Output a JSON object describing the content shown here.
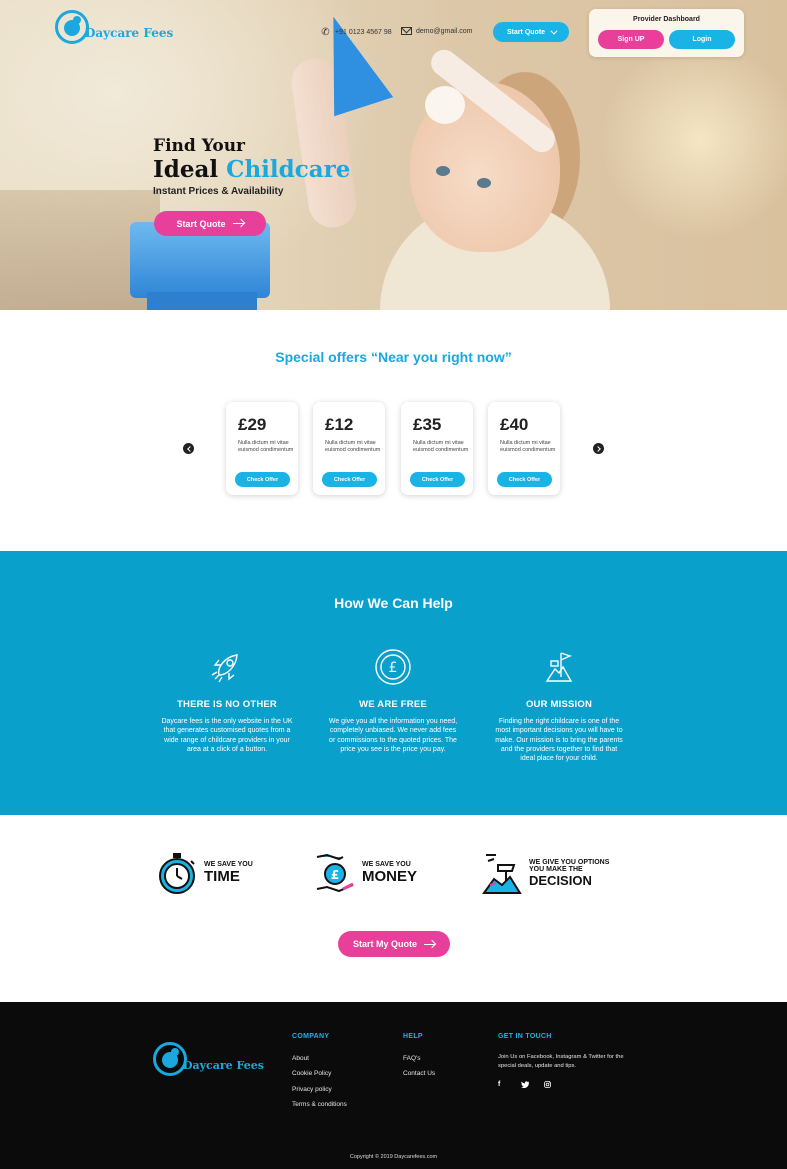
{
  "brand": {
    "name": "Daycare Fees",
    "color": "#1aa8df",
    "accent_pink": "#e8409a"
  },
  "header": {
    "phone": "+91 0123 4567 98",
    "email": "demo@gmail.com",
    "start_quote": "Start Quote",
    "provider_dashboard": {
      "title": "Provider Dashboard",
      "signup": "Sign UP",
      "login": "Login"
    }
  },
  "hero": {
    "line1": "Find Your",
    "line2_a": "Ideal",
    "line2_b": "Childcare",
    "subtitle": "Instant Prices & Availability",
    "cta": "Start Quote"
  },
  "offers": {
    "title": "Special offers “Near you right now”",
    "cards": [
      {
        "price": "£29",
        "desc": "Nulla dictum mi vitae euismod condimentum",
        "cta": "Check Offer"
      },
      {
        "price": "£12",
        "desc": "Nulla dictum mi vitae euismod condimentum",
        "cta": "Check Offer"
      },
      {
        "price": "£35",
        "desc": "Nulla dictum mi vitae euismod condimentum",
        "cta": "Check Offer"
      },
      {
        "price": "£40",
        "desc": "Nulla dictum mi vitae euismod condimentum",
        "cta": "Check Offer"
      }
    ]
  },
  "help": {
    "title": "How We Can Help",
    "columns": [
      {
        "icon": "rocket-icon",
        "heading": "THERE IS NO OTHER",
        "text": "Daycare fees is the only website in the UK that generates customised quotes from a wide range of childcare providers in your area at a click of a button."
      },
      {
        "icon": "pound-coin-icon",
        "heading": "WE ARE FREE",
        "text": "We give you all the information you need, completely unbiased. We never add fees or commissions to the quoted prices. The price you see is the price you pay."
      },
      {
        "icon": "flag-mountain-icon",
        "heading": "OUR MISSION",
        "text": "Finding the right childcare is one of the most important decisions you will have to make. Our mission is to bring the parents and the providers together to find that ideal place for your child."
      }
    ]
  },
  "benefits": [
    {
      "icon": "stopwatch-icon",
      "small": "WE SAVE YOU",
      "big": "TIME"
    },
    {
      "icon": "money-hand-icon",
      "small": "WE SAVE YOU",
      "big": "MONEY"
    },
    {
      "icon": "decision-icon",
      "small": "WE GIVE YOU OPTIONS YOU MAKE THE",
      "big": "DECISION"
    }
  ],
  "cta_bottom": "Start My Quote",
  "footer": {
    "company": {
      "heading": "COMPANY",
      "links": [
        "About",
        "Cookie Policy",
        "Privacy policy",
        "Terms & conditions"
      ]
    },
    "help": {
      "heading": "HELP",
      "links": [
        "FAQ's",
        "Contact Us"
      ]
    },
    "touch": {
      "heading": "GET IN TOUCH",
      "text": "Join Us on Facebook, Instagram & Twitter for the special deals, update and tips.",
      "socials": [
        "f",
        "t",
        "o"
      ]
    },
    "copyright": "Copyright © 2019 Daycarefees.com"
  }
}
